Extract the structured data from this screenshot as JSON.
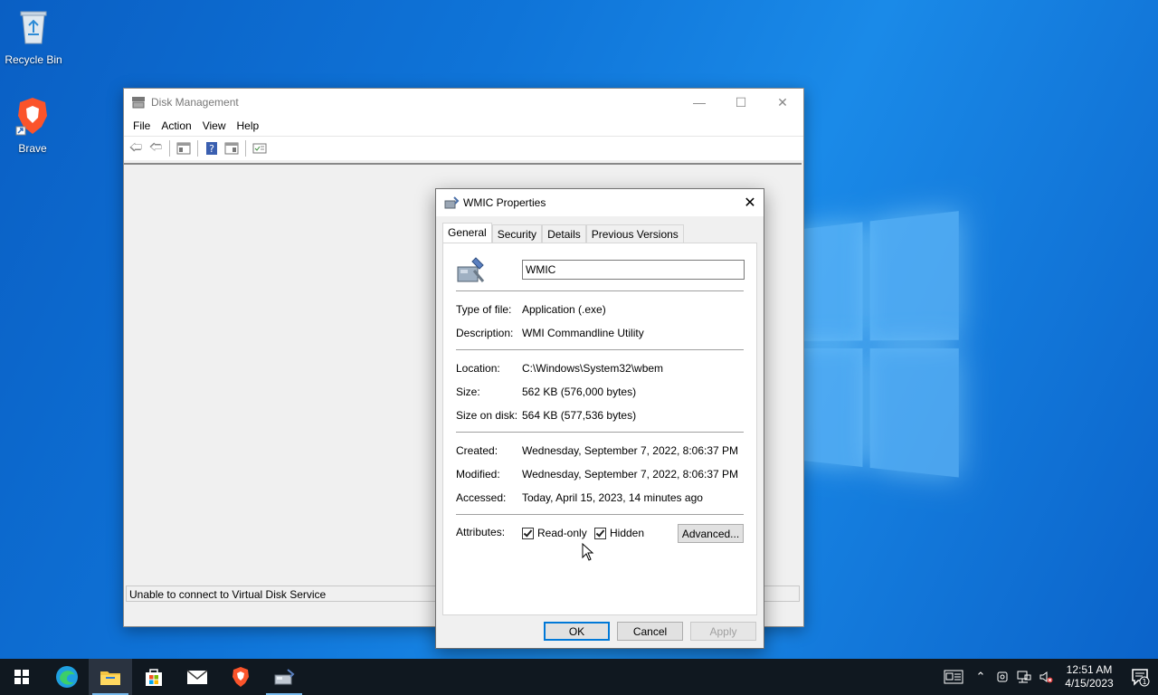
{
  "desktop": {
    "icons": [
      {
        "label": "Recycle Bin",
        "icon": "recycle-bin-icon"
      },
      {
        "label": "Brave",
        "icon": "brave-icon"
      }
    ]
  },
  "disk_management": {
    "title": "Disk Management",
    "menu": [
      "File",
      "Action",
      "View",
      "Help"
    ],
    "status": "Unable to connect to Virtual Disk Service"
  },
  "dialog": {
    "title": "WMIC Properties",
    "tabs": [
      "General",
      "Security",
      "Details",
      "Previous Versions"
    ],
    "active_tab": "General",
    "file_name": "WMIC",
    "type_label": "Type of file:",
    "type_value": "Application (.exe)",
    "description_label": "Description:",
    "description_value": "WMI Commandline Utility",
    "location_label": "Location:",
    "location_value": "C:\\Windows\\System32\\wbem",
    "size_label": "Size:",
    "size_value": "562 KB (576,000 bytes)",
    "size_on_disk_label": "Size on disk:",
    "size_on_disk_value": "564 KB (577,536 bytes)",
    "created_label": "Created:",
    "created_value": "Wednesday, September 7, 2022, 8:06:37 PM",
    "modified_label": "Modified:",
    "modified_value": "Wednesday, September 7, 2022, 8:06:37 PM",
    "accessed_label": "Accessed:",
    "accessed_value": "Today, April 15, 2023, 14 minutes ago",
    "attributes_label": "Attributes:",
    "readonly_label": "Read-only",
    "hidden_label": "Hidden",
    "advanced_label": "Advanced...",
    "ok_label": "OK",
    "cancel_label": "Cancel",
    "apply_label": "Apply"
  },
  "taskbar": {
    "time": "12:51 AM",
    "date": "4/15/2023",
    "notification_count": "1"
  },
  "colors": {
    "accent": "#0078d7",
    "taskbar": "#101820",
    "desktop": "#0f74d8"
  }
}
